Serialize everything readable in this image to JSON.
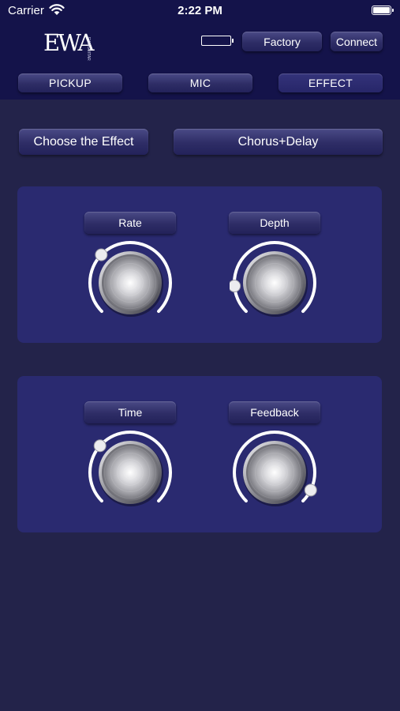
{
  "status_bar": {
    "carrier": "Carrier",
    "time": "2:22 PM"
  },
  "logo": {
    "text": "EWA",
    "subtext": "EWAGUITAR"
  },
  "header": {
    "factory_label": "Factory",
    "connect_label": "Connect"
  },
  "tabs": [
    {
      "label": "PICKUP",
      "active": false
    },
    {
      "label": "MIC",
      "active": false
    },
    {
      "label": "EFFECT",
      "active": true
    }
  ],
  "effect": {
    "choose_label": "Choose the Effect",
    "selected": "Chorus+Delay"
  },
  "knobs": [
    {
      "label": "Rate",
      "level": 0.33
    },
    {
      "label": "Depth",
      "level": 0.15
    },
    {
      "label": "Time",
      "level": 0.32
    },
    {
      "label": "Feedback",
      "level": 0.93
    }
  ],
  "colors": {
    "background": "#23234a",
    "header": "#14134a",
    "panel": "#2a2a70",
    "button": "#2e2d66"
  }
}
